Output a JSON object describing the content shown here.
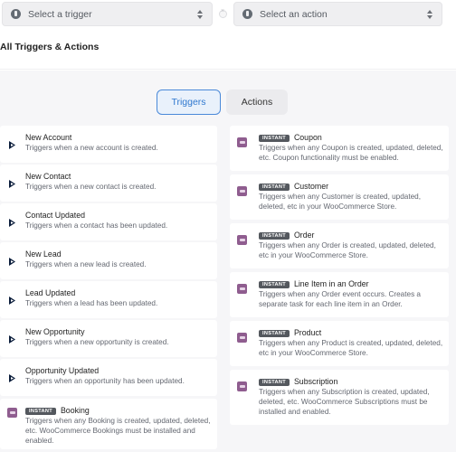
{
  "trigger_select": {
    "placeholder": "Select a trigger"
  },
  "action_select": {
    "placeholder": "Select an action"
  },
  "heading": "All Triggers & Actions",
  "tabs": {
    "triggers": "Triggers",
    "actions": "Actions"
  },
  "left_cards": [
    {
      "title": "New Account",
      "desc": "Triggers when a new account is created.",
      "icon": "dynamics-icon"
    },
    {
      "title": "New Contact",
      "desc": "Triggers when a new contact is created.",
      "icon": "dynamics-icon"
    },
    {
      "title": "Contact Updated",
      "desc": "Triggers when a contact has been updated.",
      "icon": "dynamics-icon"
    },
    {
      "title": "New Lead",
      "desc": "Triggers when a new lead is created.",
      "icon": "dynamics-icon"
    },
    {
      "title": "Lead Updated",
      "desc": "Triggers when a lead has been updated.",
      "icon": "dynamics-icon"
    },
    {
      "title": "New Opportunity",
      "desc": "Triggers when a new opportunity is created.",
      "icon": "dynamics-icon"
    },
    {
      "title": "Opportunity Updated",
      "desc": "Triggers when an opportunity has been updated.",
      "icon": "dynamics-icon"
    },
    {
      "badge": "INSTANT",
      "title": "Booking",
      "desc": "Triggers when any Booking is created, updated, deleted, etc. WooCommerce Bookings must be installed and enabled.",
      "icon": "woocommerce-icon"
    }
  ],
  "right_cards": [
    {
      "badge": "INSTANT",
      "title": "Coupon",
      "desc": "Triggers when any Coupon is created, updated, deleted, etc. Coupon functionality must be enabled.",
      "icon": "woocommerce-icon"
    },
    {
      "badge": "INSTANT",
      "title": "Customer",
      "desc": "Triggers when any Customer is created, updated, deleted, etc in your WooCommerce Store.",
      "icon": "woocommerce-icon"
    },
    {
      "badge": "INSTANT",
      "title": "Order",
      "desc": "Triggers when any Order is created, updated, deleted, etc in your WooCommerce Store.",
      "icon": "woocommerce-icon"
    },
    {
      "badge": "INSTANT",
      "title": "Line Item in an Order",
      "desc": "Triggers when any Order event occurs. Creates a separate task for each line item in an Order.",
      "icon": "woocommerce-icon"
    },
    {
      "badge": "INSTANT",
      "title": "Product",
      "desc": "Triggers when any Product is created, updated, deleted, etc in your WooCommerce Store.",
      "icon": "woocommerce-icon"
    },
    {
      "badge": "INSTANT",
      "title": "Subscription",
      "desc": "Triggers when any Subscription is created, updated, deleted, etc. WooCommerce Subscriptions must be installed and enabled.",
      "icon": "woocommerce-icon"
    }
  ]
}
